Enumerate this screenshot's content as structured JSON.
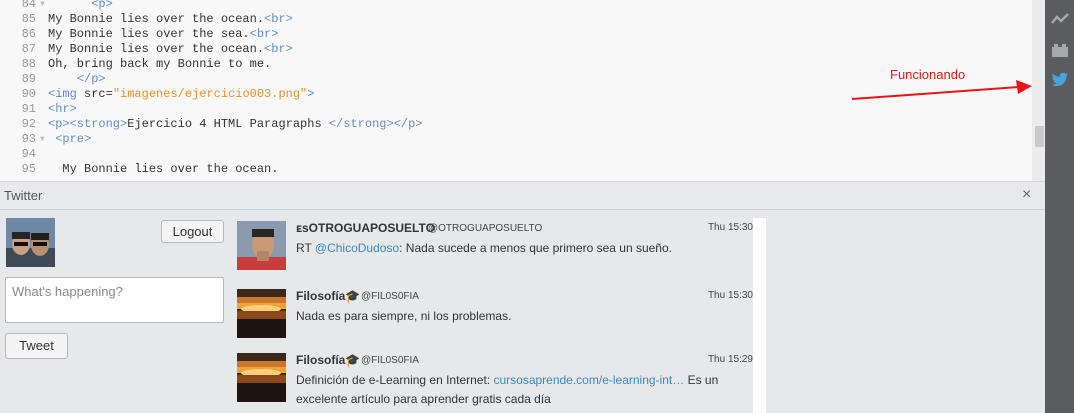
{
  "editor": {
    "lines": [
      {
        "n": "84",
        "fold": "▼",
        "parts": [
          {
            "t": "      ",
            "c": ""
          },
          {
            "t": "<p>",
            "c": "tag"
          }
        ]
      },
      {
        "n": "85",
        "fold": "",
        "parts": [
          {
            "t": "My Bonnie lies over the ocean.",
            "c": ""
          },
          {
            "t": "<br>",
            "c": "tag"
          }
        ]
      },
      {
        "n": "86",
        "fold": "",
        "parts": [
          {
            "t": "My Bonnie lies over the sea.",
            "c": ""
          },
          {
            "t": "<br>",
            "c": "tag"
          }
        ]
      },
      {
        "n": "87",
        "fold": "",
        "parts": [
          {
            "t": "My Bonnie lies over the ocean.",
            "c": ""
          },
          {
            "t": "<br>",
            "c": "tag"
          }
        ]
      },
      {
        "n": "88",
        "fold": "",
        "parts": [
          {
            "t": "Oh, bring back my Bonnie to me.",
            "c": ""
          }
        ]
      },
      {
        "n": "89",
        "fold": "",
        "parts": [
          {
            "t": "    ",
            "c": ""
          },
          {
            "t": "</p>",
            "c": "tag"
          }
        ]
      },
      {
        "n": "90",
        "fold": "",
        "parts": [
          {
            "t": "<img ",
            "c": "tag"
          },
          {
            "t": "src=",
            "c": "attr"
          },
          {
            "t": "\"imagenes/ejercicio003.png\"",
            "c": "str"
          },
          {
            "t": ">",
            "c": "tag"
          }
        ]
      },
      {
        "n": "91",
        "fold": "",
        "parts": [
          {
            "t": "<hr>",
            "c": "tag"
          }
        ]
      },
      {
        "n": "92",
        "fold": "",
        "parts": [
          {
            "t": "<p><strong>",
            "c": "tag"
          },
          {
            "t": "Ejercicio 4 HTML Paragraphs ",
            "c": ""
          },
          {
            "t": "</strong></p>",
            "c": "tag"
          }
        ]
      },
      {
        "n": "93",
        "fold": "▼",
        "parts": [
          {
            "t": " ",
            "c": ""
          },
          {
            "t": "<pre>",
            "c": "tag"
          }
        ]
      },
      {
        "n": "94",
        "fold": "",
        "parts": []
      },
      {
        "n": "95",
        "fold": "",
        "parts": [
          {
            "t": "  My Bonnie lies over the ocean.",
            "c": ""
          }
        ]
      }
    ]
  },
  "annotation": {
    "text": "Funcionando",
    "color": "#e8141a"
  },
  "toolbar": {
    "icons": [
      {
        "name": "live-preview-icon"
      },
      {
        "name": "extension-manager-icon"
      },
      {
        "name": "twitter-icon"
      }
    ]
  },
  "panel": {
    "title": "Twitter",
    "close": "×"
  },
  "composer": {
    "logout_label": "Logout",
    "placeholder": "What's happening?",
    "tweet_label": "Tweet"
  },
  "tweets": [
    {
      "name": "ᴇsOTROGUAPOSUELTO",
      "handle": "@OTROGUAPOSUELTO",
      "time": "Thu 15:30",
      "avatar": "selfie",
      "segments": [
        {
          "t": "RT ",
          "c": ""
        },
        {
          "t": "@ChicoDudoso",
          "c": "mention"
        },
        {
          "t": ": Nada sucede a menos que primero sea un sueño.",
          "c": ""
        }
      ]
    },
    {
      "name": "Filosofía🎓",
      "handle": "@FIL0S0FIA",
      "time": "Thu 15:30",
      "avatar": "sunset",
      "segments": [
        {
          "t": "Nada es para siempre, ni los problemas.",
          "c": ""
        }
      ]
    },
    {
      "name": "Filosofía🎓",
      "handle": "@FIL0S0FIA",
      "time": "Thu 15:29",
      "avatar": "sunset",
      "segments": [
        {
          "t": "Definición de e-Learning en Internet: ",
          "c": ""
        },
        {
          "t": "cursosaprende.com/e-learning-int…",
          "c": "link"
        },
        {
          "t": " Es un excelente artículo para aprender gratis cada día",
          "c": ""
        }
      ]
    }
  ],
  "colors": {
    "mention": "#3b88c3",
    "tag": "#5e8ec8",
    "string": "#e8902a",
    "toolbar_bg": "#5a5c60",
    "twitter_blue": "#4aa3df"
  }
}
